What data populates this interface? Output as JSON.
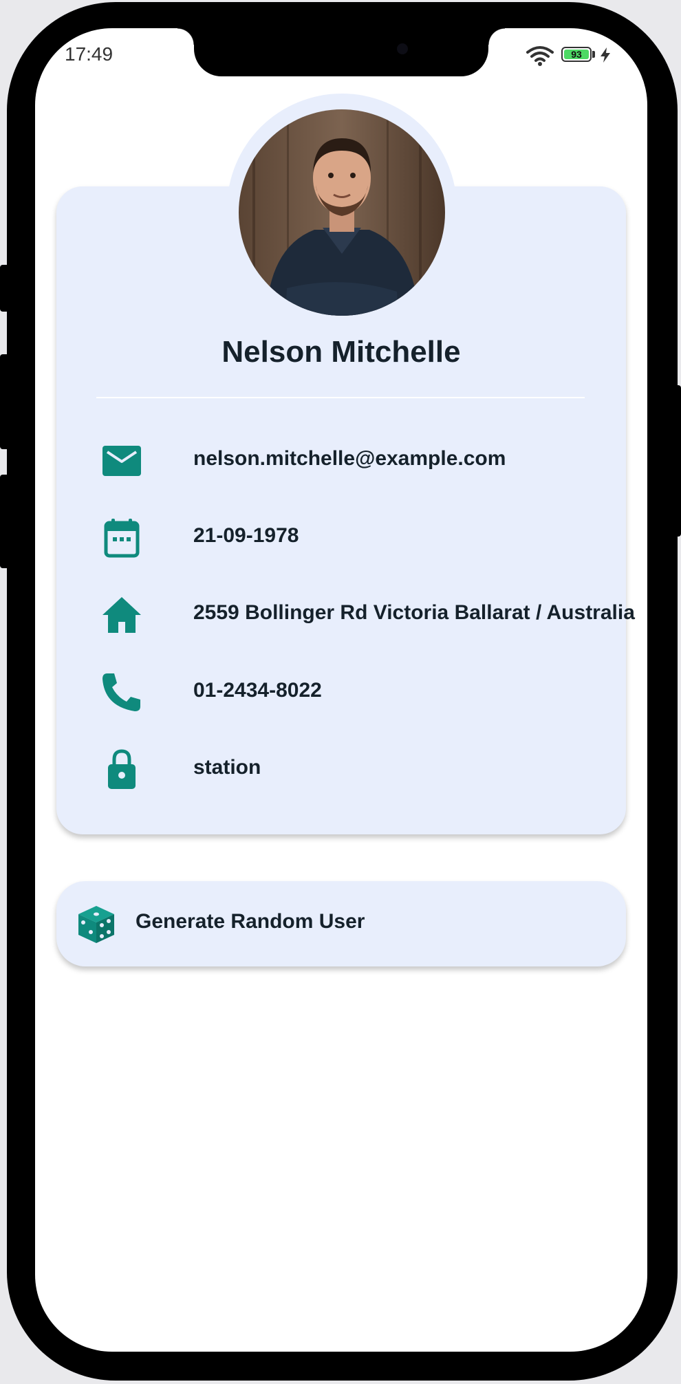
{
  "status_bar": {
    "time": "17:49",
    "battery": "93",
    "battery_color": "#4cd964"
  },
  "colors": {
    "accent": "#0f8a7d",
    "card_background": "#e8eefc",
    "text": "#15212b"
  },
  "profile": {
    "name": "Nelson Mitchelle",
    "avatar_alt": "Nelson Mitchelle",
    "details": [
      {
        "icon": "mail-icon",
        "value": "nelson.mitchelle@example.com"
      },
      {
        "icon": "calendar-icon",
        "value": "21-09-1978"
      },
      {
        "icon": "home-icon",
        "value": "2559 Bollinger Rd Victoria Ballarat / Australia"
      },
      {
        "icon": "phone-icon",
        "value": "01-2434-8022"
      },
      {
        "icon": "lock-icon",
        "value": "station"
      }
    ]
  },
  "actions": {
    "generate_label": "Generate Random User",
    "generate_icon": "dice-icon"
  }
}
